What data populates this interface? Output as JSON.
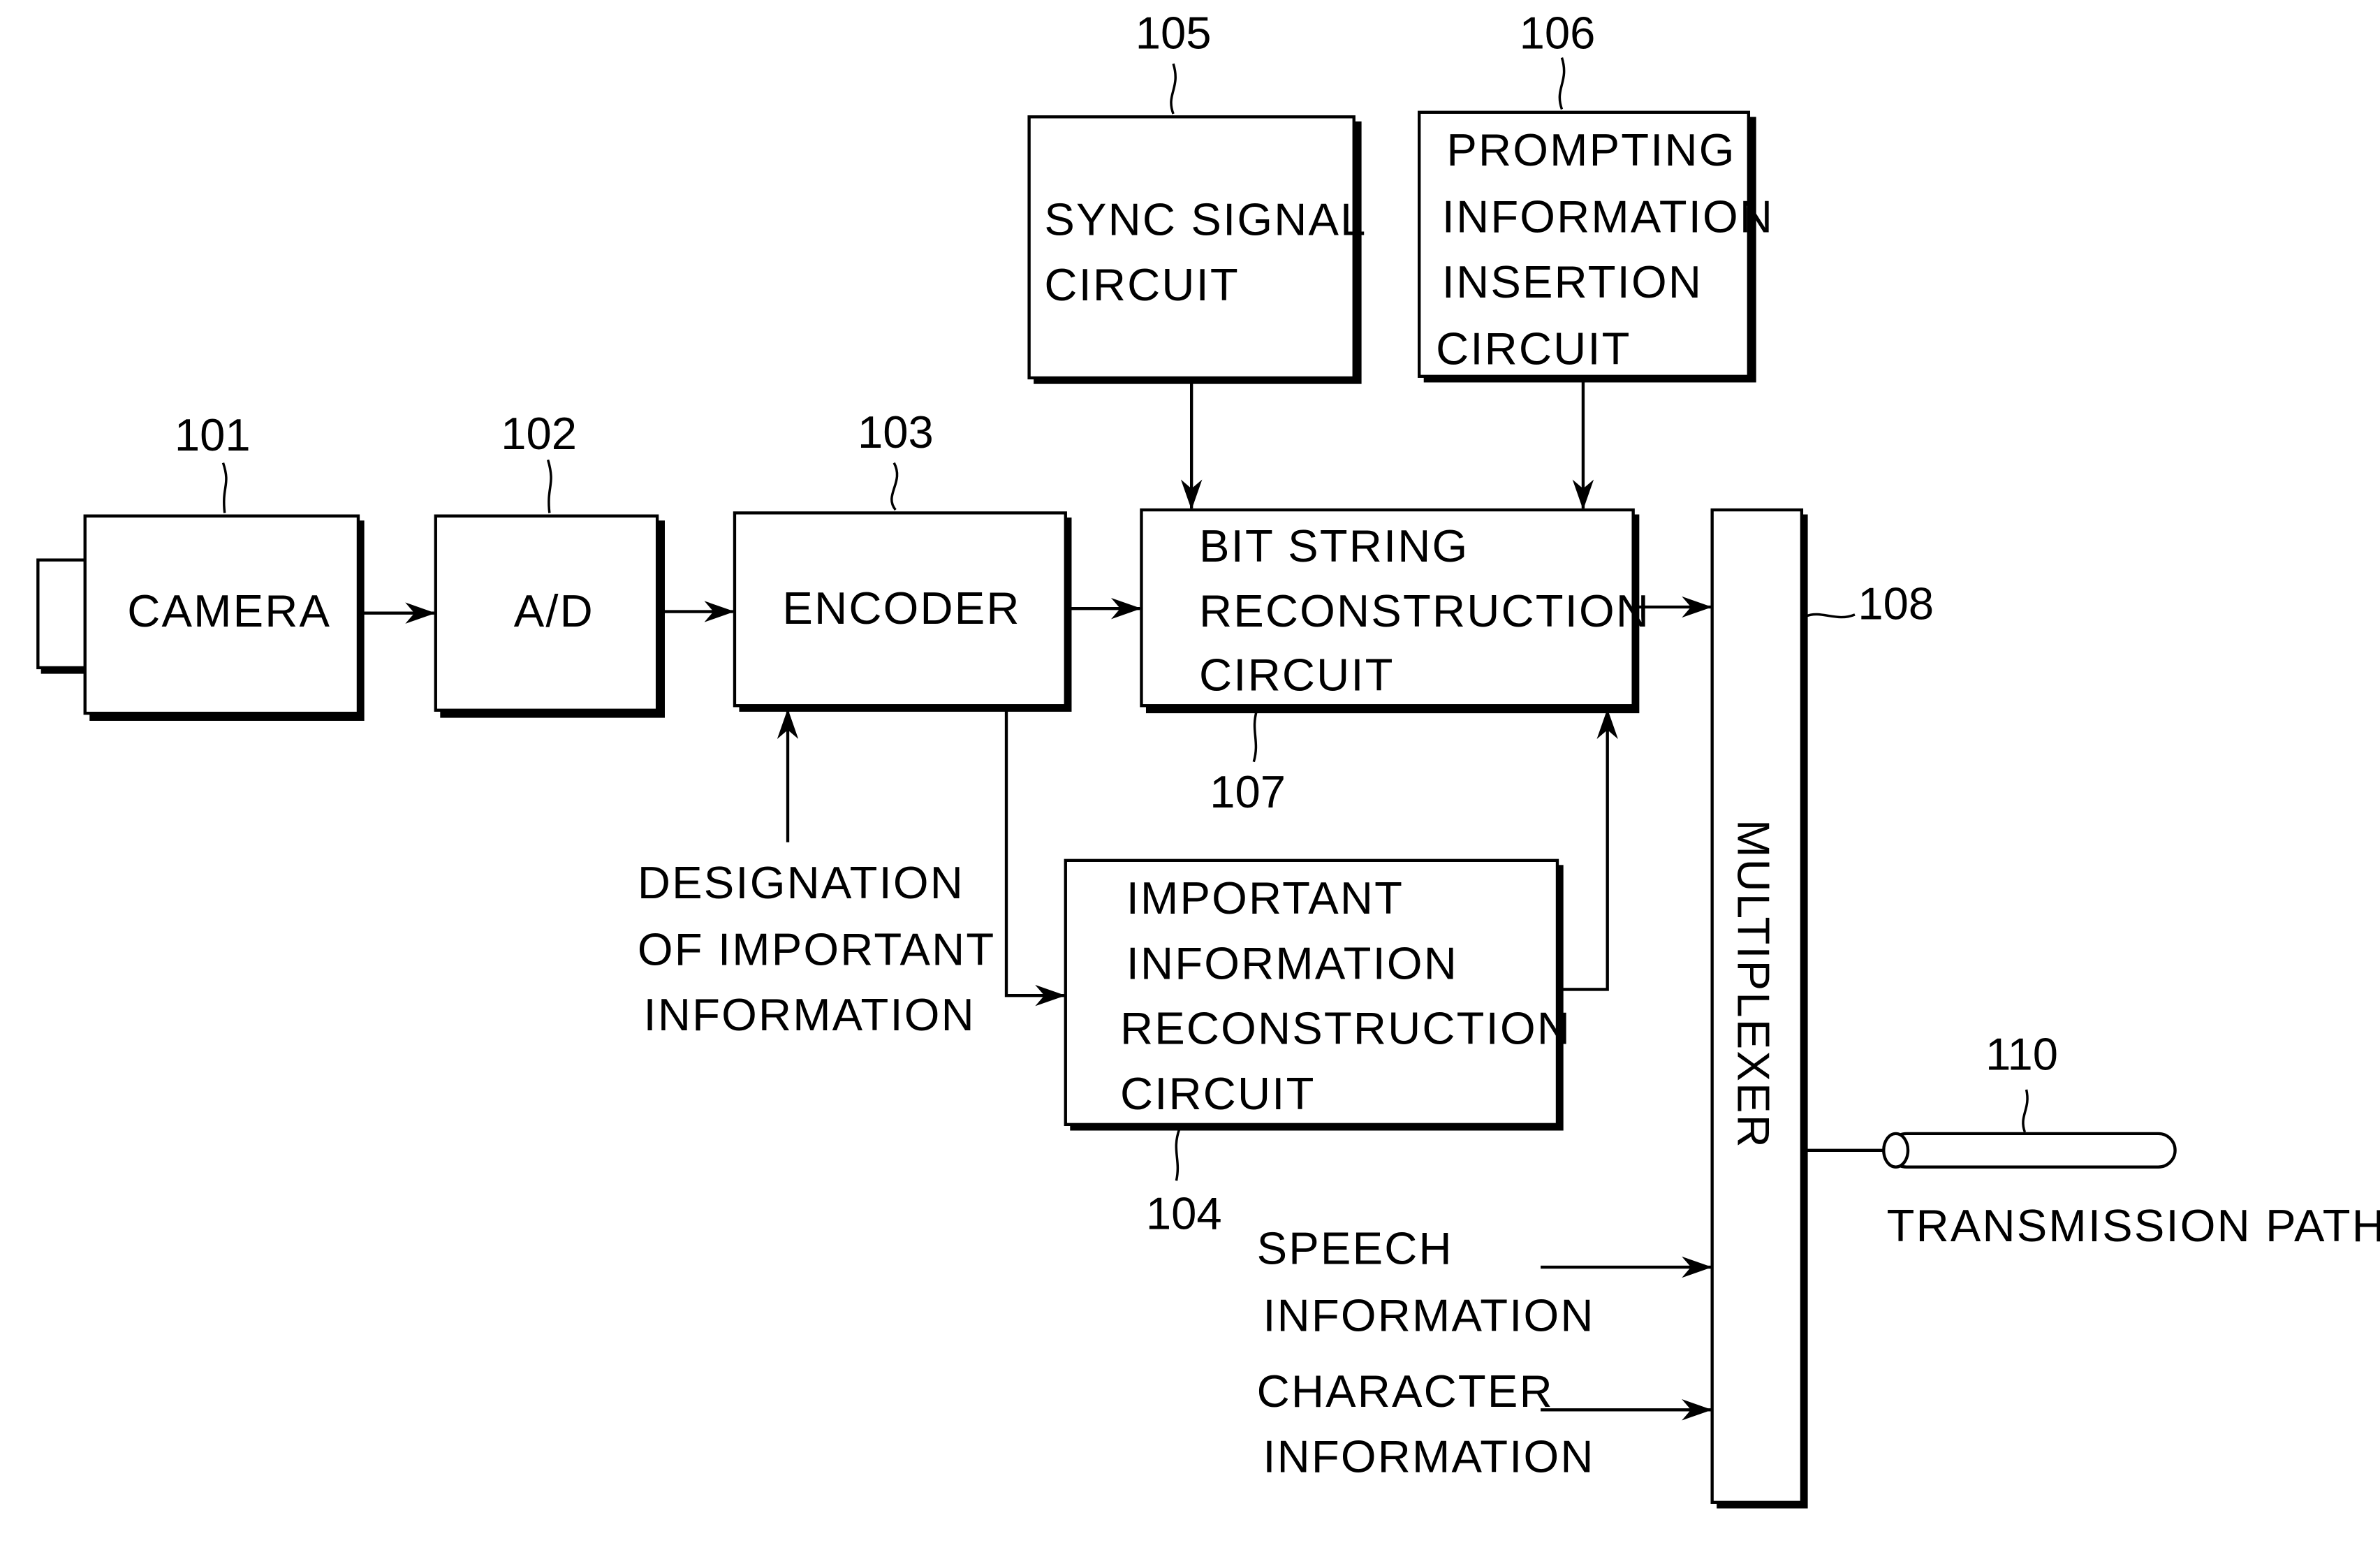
{
  "figure": {
    "blocks": {
      "camera": {
        "ref": "101",
        "lines": [
          "CAMERA"
        ]
      },
      "ad": {
        "ref": "102",
        "lines": [
          "A/D"
        ]
      },
      "encoder": {
        "ref": "103",
        "lines": [
          "ENCODER"
        ]
      },
      "important_info": {
        "ref": "104",
        "lines": [
          "IMPORTANT",
          "INFORMATION",
          "RECONSTRUCTION",
          "CIRCUIT"
        ]
      },
      "sync_signal": {
        "ref": "105",
        "lines": [
          "SYNC SIGNAL",
          "CIRCUIT"
        ]
      },
      "prompting": {
        "ref": "106",
        "lines": [
          "PROMPTING",
          "INFORMATION",
          "INSERTION",
          "CIRCUIT"
        ]
      },
      "bit_string": {
        "ref": "107",
        "lines": [
          "BIT STRING",
          "RECONSTRUCTION",
          "CIRCUIT"
        ]
      },
      "multiplexer": {
        "ref": "108",
        "lines": [
          "MULTIPLEXER"
        ]
      },
      "transmission_path": {
        "ref": "110",
        "lines": [
          "TRANSMISSION PATH"
        ]
      }
    },
    "inputs": {
      "designation": [
        "DESIGNATION",
        "OF IMPORTANT",
        "INFORMATION"
      ],
      "speech": [
        "SPEECH",
        "INFORMATION"
      ],
      "character": [
        "CHARACTER",
        "INFORMATION"
      ]
    }
  }
}
